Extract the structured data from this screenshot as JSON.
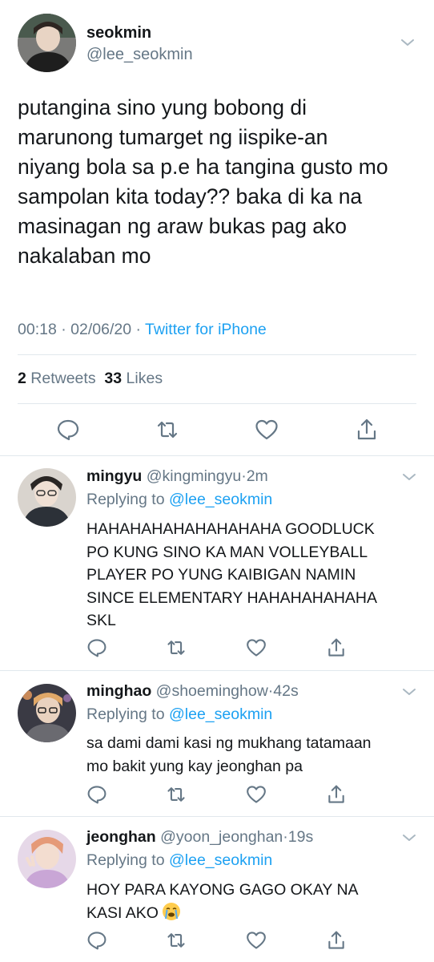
{
  "main_tweet": {
    "display_name": "seokmin",
    "handle": "@lee_seokmin",
    "lines": [
      "putangina sino yung bobong di",
      "marunong tumarget ng iispike-an",
      "niyang bola sa p.e ha tangina gusto mo",
      "sampolan kita today?? baka di ka na",
      "masinagan ng araw bukas pag ako",
      "nakalaban mo"
    ],
    "time": "00:18",
    "date": "02/06/20",
    "source": "Twitter for iPhone",
    "retweet_count": "2",
    "retweet_label": "Retweets",
    "like_count": "33",
    "like_label": "Likes",
    "icons": [
      "reply-icon",
      "retweet-icon",
      "like-icon",
      "share-icon",
      "chevron-down-icon"
    ]
  },
  "replies": [
    {
      "display_name": "mingyu",
      "handle": "@kingmingyu",
      "age": "2m",
      "replying_prefix": "Replying to",
      "replying_to": "@lee_seokmin",
      "lines": [
        "HAHAHAHAHAHAHAHAHA GOODLUCK",
        "PO KUNG SINO KA MAN VOLLEYBALL",
        "PLAYER PO YUNG KAIBIGAN NAMIN",
        "SINCE ELEMENTARY HAHAHAHAHAHA",
        "SKL"
      ]
    },
    {
      "display_name": "minghao",
      "handle": "@shoeminghow",
      "age": "42s",
      "replying_prefix": "Replying to",
      "replying_to": "@lee_seokmin",
      "lines": [
        "sa dami dami kasi ng mukhang tatamaan",
        "mo bakit yung kay jeonghan pa"
      ]
    },
    {
      "display_name": "jeonghan",
      "handle": "@yoon_jeonghan",
      "age": "19s",
      "replying_prefix": "Replying to",
      "replying_to": "@lee_seokmin",
      "lines": [
        "HOY PARA KAYONG GAGO OKAY NA",
        "KASI AKO"
      ],
      "emoji": "loudly-crying-face-emoji"
    }
  ],
  "colors": {
    "text": "#14171a",
    "secondary": "#657786",
    "accent": "#1da1f2",
    "divider": "#e1e8ed"
  }
}
